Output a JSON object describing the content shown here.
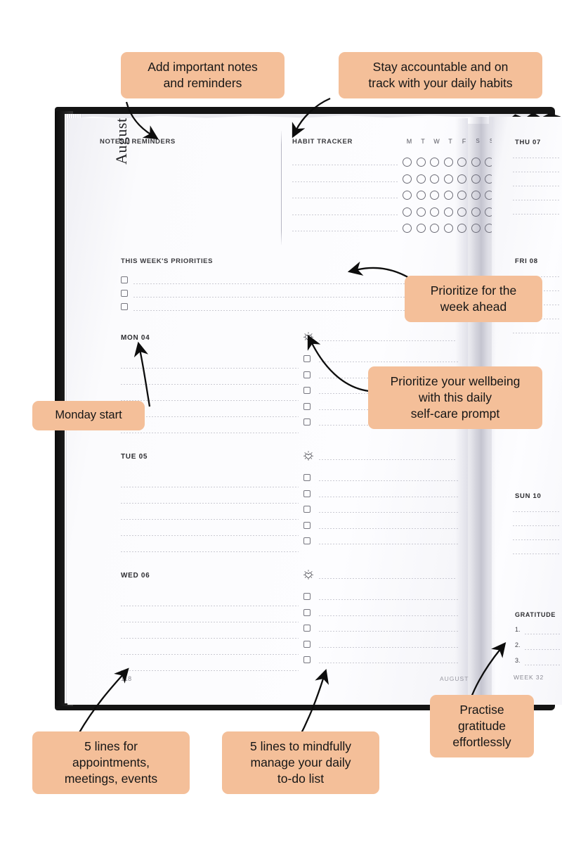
{
  "colors": {
    "callout_bg": "#f4bf99",
    "cover": "#141414",
    "page": "#fbfbfd",
    "ink": "#2d2d31",
    "rule": "#b9b9c4"
  },
  "callouts": [
    {
      "id": "notes",
      "text": "Add important notes\nand reminders",
      "name": "callout-notes"
    },
    {
      "id": "habits",
      "text": "Stay accountable and on\ntrack with your daily habits",
      "name": "callout-habits"
    },
    {
      "id": "priorities",
      "text": "Prioritize for the\nweek ahead",
      "name": "callout-priorities"
    },
    {
      "id": "selfcare",
      "text": "Prioritize your wellbeing\nwith this daily\nself-care prompt",
      "name": "callout-selfcare"
    },
    {
      "id": "monday",
      "text": "Monday start",
      "name": "callout-monday-start"
    },
    {
      "id": "appts",
      "text": "5 lines for\nappointments,\nmeetings, events",
      "name": "callout-appointments"
    },
    {
      "id": "todo",
      "text": "5 lines to mindfully\nmanage your daily\nto-do list",
      "name": "callout-todo"
    },
    {
      "id": "gratitude",
      "text": "Practise\ngratitude\neffortlessly",
      "name": "callout-gratitude"
    }
  ],
  "left_page": {
    "month_label": "August",
    "notes": {
      "title": "NOTES / REMINDERS"
    },
    "habit_tracker": {
      "title": "HABIT TRACKER",
      "day_initials": [
        "M",
        "T",
        "W",
        "T",
        "F",
        "S",
        "S"
      ],
      "row_count": 5,
      "circles_per_row": 7
    },
    "priorities": {
      "title": "THIS WEEK'S PRIORITIES",
      "row_count": 3
    },
    "days": [
      {
        "label": "MON 04",
        "lines": 5,
        "todos": 5,
        "selfcare_icon": "heart-shine-icon"
      },
      {
        "label": "TUE 05",
        "lines": 5,
        "todos": 5,
        "selfcare_icon": "heart-shine-icon"
      },
      {
        "label": "WED 06",
        "lines": 5,
        "todos": 5,
        "selfcare_icon": "heart-shine-icon"
      }
    ],
    "footer": {
      "page_number": "118",
      "month": "AUGUST"
    }
  },
  "right_page": {
    "days": [
      {
        "label": "THU 07",
        "lines": 5
      },
      {
        "label": "FRI 08",
        "lines": 5
      },
      {
        "label": "SUN 10",
        "lines": 4
      }
    ],
    "gratitude": {
      "title": "GRATITUDE",
      "items": [
        "1.",
        "2.",
        "3."
      ]
    },
    "week_label": "WEEK 32"
  }
}
